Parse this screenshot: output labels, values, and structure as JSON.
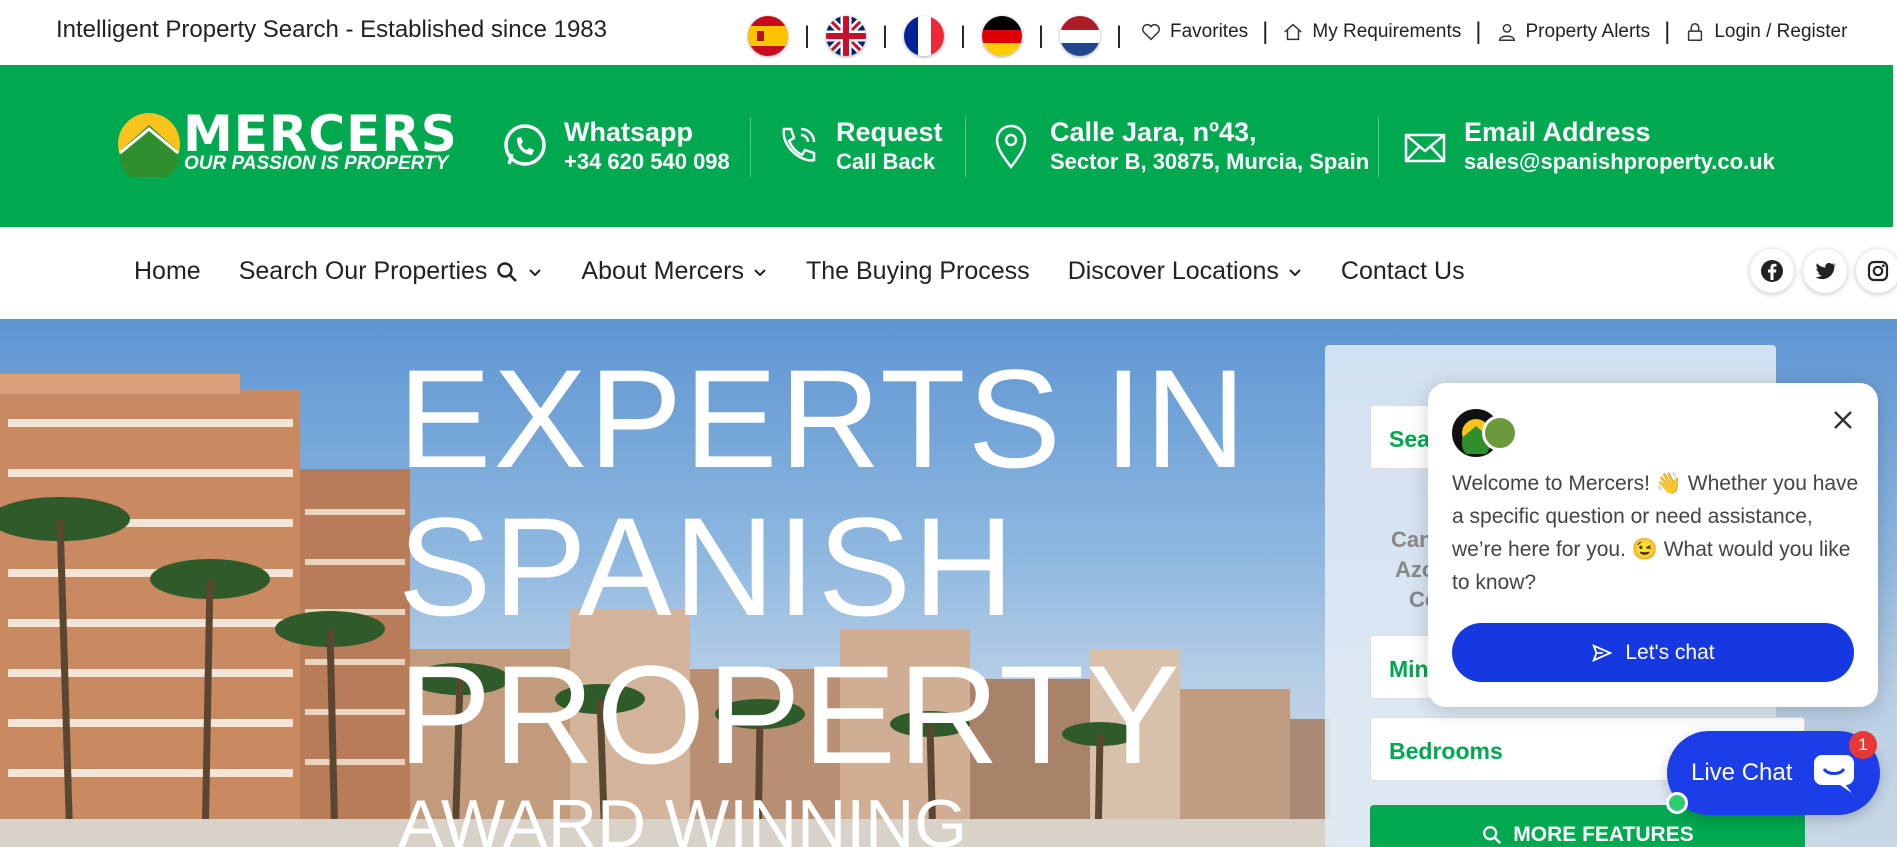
{
  "topbar": {
    "tagline": "Intelligent Property Search - Established since 1983",
    "flags": [
      "spanish-flag",
      "uk-flag",
      "french-flag",
      "german-flag",
      "dutch-flag"
    ],
    "separator": "|",
    "links": [
      {
        "label": "Favorites",
        "icon": "heart-icon"
      },
      {
        "label": "My Requirements",
        "icon": "house-icon"
      },
      {
        "label": "Property Alerts",
        "icon": "user-icon"
      },
      {
        "label": "Login / Register",
        "icon": "lock-icon"
      }
    ]
  },
  "header": {
    "logo_text": "MERCERS",
    "logo_tagline": "OUR PASSION IS PROPERTY",
    "whatsapp": {
      "title": "Whatsapp",
      "sub": "+34 620 540 098"
    },
    "callback": {
      "title": "Request",
      "sub": "Call Back"
    },
    "address": {
      "title": "Calle Jara, nº43,",
      "sub": "Sector B, 30875, Murcia, Spain"
    },
    "email": {
      "title": "Email Address",
      "sub": "sales@spanishproperty.co.uk"
    }
  },
  "nav": {
    "items": [
      "Home",
      "Search Our Properties",
      "About Mercers",
      "The Buying Process",
      "Discover Locations",
      "Contact Us"
    ],
    "social": [
      "facebook-icon",
      "twitter-icon",
      "instagram-icon"
    ]
  },
  "hero": {
    "heading_line1": "EXPERTS IN",
    "heading_line2": "SPANISH",
    "heading_line3": "PROPERTY",
    "subheading": "AWARD WINNING"
  },
  "search_panel": {
    "field1": "Sea",
    "loc_line1": "Can",
    "loc_line2": "Azo",
    "loc_line3": "Co",
    "min_field": "Min",
    "bedrooms_field": "Bedrooms",
    "more_button": "MORE FEATURES"
  },
  "chat": {
    "message": "Welcome to Mercers! 👋 Whether you have a specific question or need assistance, we’re here for you. 😉 What would you like to know?",
    "button": "Let's chat",
    "launcher": "Live Chat",
    "badge": "1"
  },
  "colors": {
    "brand_green": "#00a84f",
    "chat_blue": "#1638e0"
  }
}
